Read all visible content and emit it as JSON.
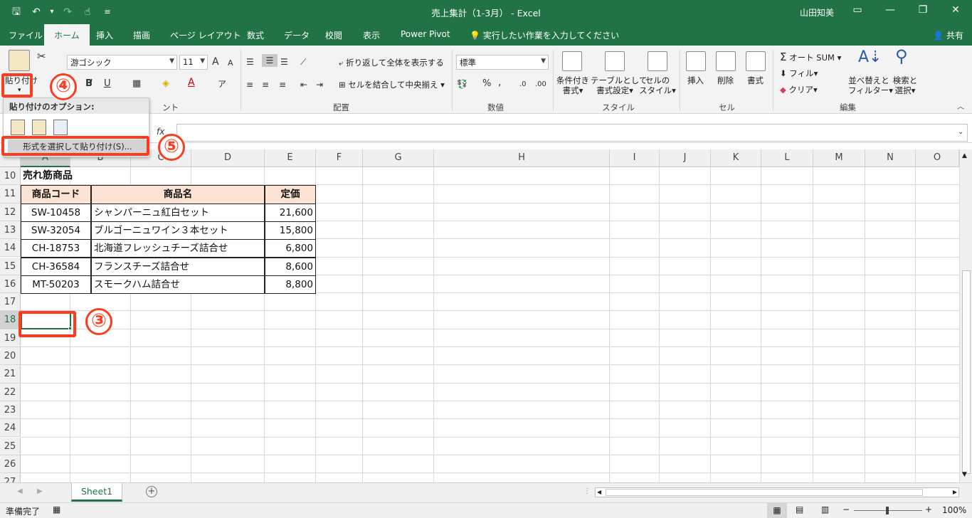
{
  "window": {
    "title": "売上集計（1-3月） - Excel",
    "user": "山田知美",
    "minimize_icon": "ロ",
    "restore_icon": "❐",
    "close_icon": "✕"
  },
  "qat": {
    "save": "🖫",
    "undo": "↶",
    "undo_dd": "▾",
    "redo": "↷",
    "touch": "☝",
    "customize": "≡"
  },
  "tabs": [
    "ファイル",
    "ホーム",
    "挿入",
    "描画",
    "ページ レイアウト",
    "数式",
    "データ",
    "校閲",
    "表示",
    "Power Pivot"
  ],
  "tell_me": "実行したい作業を入力してください",
  "share": "共有",
  "ribbon": {
    "paste_label": "貼り付け",
    "paste_dd": "▾",
    "font_name": "游ゴシック",
    "font_size": "11",
    "bold": "B",
    "italic": "I",
    "underline": "U",
    "increase_font": "A",
    "decrease_font": "A",
    "font_group_tail": "ント",
    "wrap_text": "折り返して全体を表示する",
    "merge_center": "セルを結合して中央揃え",
    "alignment_group": "配置",
    "number_format": "標準",
    "percent": "%",
    "comma": ",",
    "number_group": "数値",
    "conditional_format": [
      "条件付き",
      "書式▾"
    ],
    "format_as_table": [
      "テーブルとして",
      "書式設定▾"
    ],
    "cell_styles": [
      "セルの",
      "スタイル▾"
    ],
    "styles_group": "スタイル",
    "insert": "挿入",
    "delete": "削除",
    "format": "書式",
    "cells_group": "セル",
    "autosum": "オート SUM",
    "fill": "フィル▾",
    "clear": "クリア▾",
    "sort_filter": [
      "並べ替えと",
      "フィルター▾"
    ],
    "find_select": [
      "検索と",
      "選択▾"
    ],
    "editing_group": "編集"
  },
  "paste_popup": {
    "options_title": "貼り付けのオプション:",
    "paste_special": "形式を選択して貼り付け(S)..."
  },
  "formula_bar": {
    "fx": "fx",
    "value": ""
  },
  "columns": [
    "A",
    "B",
    "C",
    "D",
    "E",
    "F",
    "G",
    "H",
    "I",
    "J",
    "K",
    "L",
    "M",
    "N",
    "O"
  ],
  "rows": [
    "10",
    "11",
    "12",
    "13",
    "14",
    "15",
    "16",
    "17",
    "18",
    "19",
    "20",
    "21",
    "22",
    "23",
    "24",
    "25",
    "26",
    "27"
  ],
  "table": {
    "title": "売れ筋商品",
    "headers": [
      "商品コード",
      "商品名",
      "定価"
    ],
    "rows": [
      [
        "SW-10458",
        "シャンパーニュ紅白セット",
        "21,600"
      ],
      [
        "SW-32054",
        "ブルゴーニュワイン３本セット",
        "15,800"
      ],
      [
        "CH-18753",
        "北海道フレッシュチーズ詰合せ",
        "6,800"
      ],
      [
        "CH-36584",
        "フランスチーズ詰合せ",
        "8,600"
      ],
      [
        "MT-50203",
        "スモークハム詰合せ",
        "8,800"
      ]
    ]
  },
  "sheet_tab": "Sheet1",
  "add_sheet": "+",
  "status": {
    "ready": "準備完了",
    "zoom": "100%",
    "zoom_minus": "−",
    "zoom_plus": "+"
  },
  "annotations": {
    "step3": "③",
    "step4": "④",
    "step5": "⑤"
  },
  "colors": {
    "excel_green": "#217346",
    "header_fill": "#fde3d3",
    "highlight_red": "#ff3b1f"
  }
}
